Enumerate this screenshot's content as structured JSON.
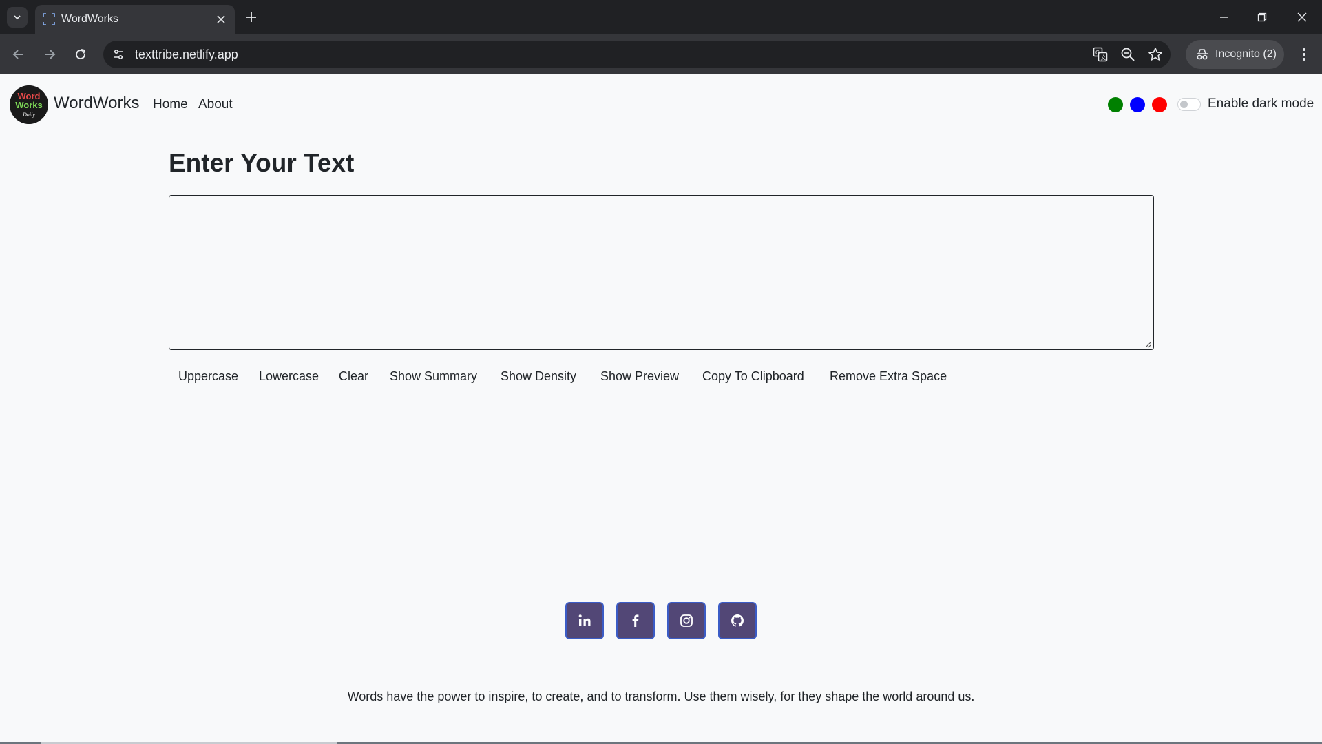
{
  "browser": {
    "tab_title": "WordWorks",
    "url": "texttribe.netlify.app",
    "incognito_label": "Incognito (2)"
  },
  "navbar": {
    "brand": "WordWorks",
    "links": [
      "Home",
      "About"
    ],
    "swatch_colors": [
      "#008000",
      "#0000ff",
      "#ff0000"
    ],
    "dark_mode_label": "Enable dark mode",
    "dark_mode_enabled": false
  },
  "main": {
    "heading": "Enter Your Text",
    "textarea_value": "",
    "actions": [
      "Uppercase",
      "Lowercase",
      "Clear",
      "Show Summary",
      "Show Density",
      "Show Preview",
      "Copy To Clipboard",
      "Remove Extra Space"
    ]
  },
  "footer": {
    "social_icons": [
      "linkedin-icon",
      "facebook-icon",
      "instagram-icon",
      "github-icon"
    ],
    "quote": "Words have the power to inspire, to create, and to transform. Use them wisely, for they shape the world around us."
  }
}
